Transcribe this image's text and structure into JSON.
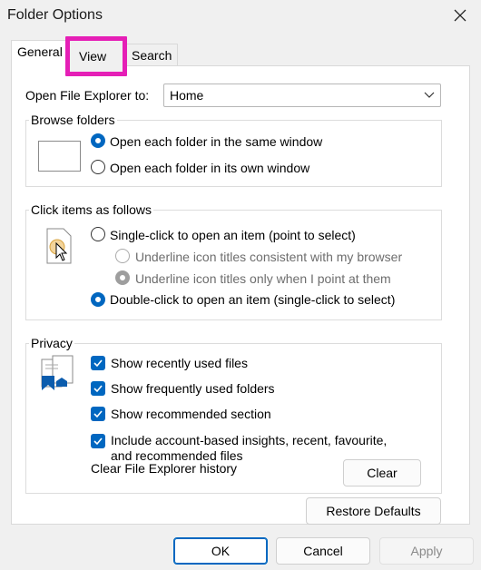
{
  "window": {
    "title": "Folder Options"
  },
  "tabs": [
    {
      "label": "General",
      "active": true
    },
    {
      "label": "View",
      "active": false
    },
    {
      "label": "Search",
      "active": false
    }
  ],
  "general": {
    "open_explorer_label": "Open File Explorer to:",
    "open_explorer_value": "Home",
    "browse_folders": {
      "title": "Browse folders",
      "options": [
        {
          "label": "Open each folder in the same window",
          "checked": true
        },
        {
          "label": "Open each folder in its own window",
          "checked": false
        }
      ]
    },
    "click_items": {
      "title": "Click items as follows",
      "options": [
        {
          "label": "Single-click to open an item (point to select)",
          "checked": false
        },
        {
          "label": "Underline icon titles consistent with my browser",
          "checked": false,
          "disabled": true
        },
        {
          "label": "Underline icon titles only when I point at them",
          "checked": true,
          "disabled": true
        },
        {
          "label": "Double-click to open an item (single-click to select)",
          "checked": true
        }
      ]
    },
    "privacy": {
      "title": "Privacy",
      "checkboxes": [
        {
          "label": "Show recently used files",
          "checked": true
        },
        {
          "label": "Show frequently used folders",
          "checked": true
        },
        {
          "label": "Show recommended section",
          "checked": true
        },
        {
          "label_line1": "Include account-based insights, recent, favourite,",
          "label_line2": "and recommended files",
          "checked": true
        }
      ],
      "clear_history_label": "Clear File Explorer history",
      "clear_button": "Clear"
    },
    "restore_defaults": "Restore Defaults"
  },
  "footer": {
    "ok": "OK",
    "cancel": "Cancel",
    "apply": "Apply"
  },
  "colors": {
    "accent": "#0067c0",
    "highlight": "#e51fb6"
  }
}
